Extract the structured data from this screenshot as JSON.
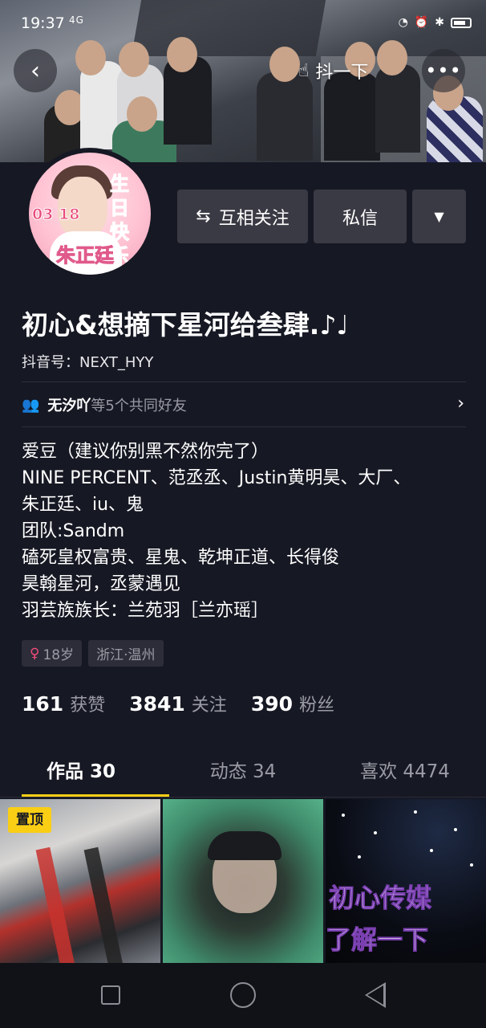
{
  "status_bar": {
    "time": "19:37",
    "signal": "4G",
    "icons": [
      "wifi-icon",
      "nfc-icon",
      "alarm-icon",
      "bluetooth-icon",
      "battery-icon"
    ]
  },
  "header": {
    "shake_label": "抖一下",
    "icons": {
      "back": "back-icon",
      "more": "more-icon",
      "shake": "hand-icon"
    }
  },
  "avatar": {
    "text_birthday": "生日快乐",
    "text_date": "03 18",
    "text_name": "朱正廷"
  },
  "actions": {
    "follow_label": "互相关注",
    "follow_icon": "swap-arrows-icon",
    "message_label": "私信",
    "dropdown_icon": "triangle-down-icon"
  },
  "profile": {
    "nickname": "初心&想摘下星河给叁肆.♪♩",
    "id_label": "抖音号：",
    "id_value": "NEXT_HYY"
  },
  "mutual": {
    "icon": "people-icon",
    "friend_name": "无汐吖",
    "rest_text": "等5个共同好友"
  },
  "bio": [
    "爱豆（建议你别黑不然你完了）",
    "NINE  PERCENT、范丞丞、Justin黄明昊、大厂、",
    "朱正廷、iu、鬼",
    "团队:Sandm",
    "磕死皇权富贵、星鬼、乾坤正道、长得俊",
    "昊翰星河，丞蒙遇见",
    "羽芸族族长：兰苑羽［兰亦瑶］"
  ],
  "tags": {
    "age": "18岁",
    "location": "浙江·温州"
  },
  "stats": [
    {
      "num": "161",
      "label": "获赞"
    },
    {
      "num": "3841",
      "label": "关注"
    },
    {
      "num": "390",
      "label": "粉丝"
    }
  ],
  "tabs": [
    {
      "label": "作品 30",
      "active": true
    },
    {
      "label": "动态 34",
      "active": false
    },
    {
      "label": "喜欢 4474",
      "active": false
    }
  ],
  "videos": {
    "pin_label": "置顶",
    "promo_line1": "初心传媒",
    "promo_line2": "了解一下"
  },
  "colors": {
    "background": "#161823",
    "accent": "#face15",
    "button": "#3a3a44",
    "muted": "#9a9ba4",
    "female": "#f14b7a"
  }
}
